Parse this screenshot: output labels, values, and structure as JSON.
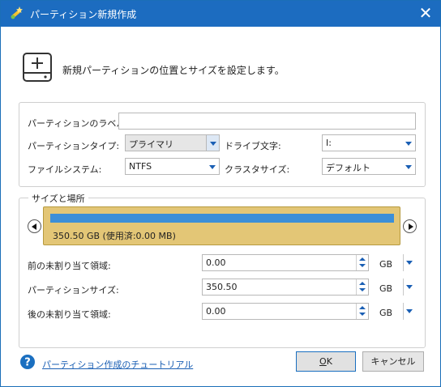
{
  "window": {
    "title": "パーティション新規作成",
    "close_glyph": "✕",
    "app_icon": "wand-icon"
  },
  "header": {
    "icon": "add-partition-icon",
    "text": "新規パーティションの位置とサイズを設定します。"
  },
  "properties": {
    "label_caption": "パーティションのラベル:",
    "label_value": "",
    "type_caption": "パーティションタイプ:",
    "type_value": "プライマリ",
    "drive_caption": "ドライブ文字:",
    "drive_value": "I:",
    "fs_caption": "ファイルシステム:",
    "fs_value": "NTFS",
    "cluster_caption": "クラスタサイズ:",
    "cluster_value": "デフォルト"
  },
  "size_location": {
    "legend": "サイズと場所",
    "partition_text": "350.50 GB (使用済:0.00 MB)",
    "partition_fill_fraction": 1.0,
    "rows": [
      {
        "caption": "前の未割り当て領域:",
        "value": "0.00",
        "unit": "GB"
      },
      {
        "caption": "パーティションサイズ:",
        "value": "350.50",
        "unit": "GB"
      },
      {
        "caption": "後の未割り当て領域:",
        "value": "0.00",
        "unit": "GB"
      }
    ]
  },
  "footer": {
    "help_icon": "question-circle-icon",
    "tutorial_link": "パーティション作成のチュートリアル",
    "ok_label": "OK",
    "ok_mnemonic": "O",
    "ok_rest": "K",
    "cancel_label": "キャンセル"
  },
  "colors": {
    "titlebar": "#1c6cc0",
    "partition_bar": "#e3c676",
    "partition_fill": "#3c8fd8",
    "accent": "#1a5fb4"
  }
}
